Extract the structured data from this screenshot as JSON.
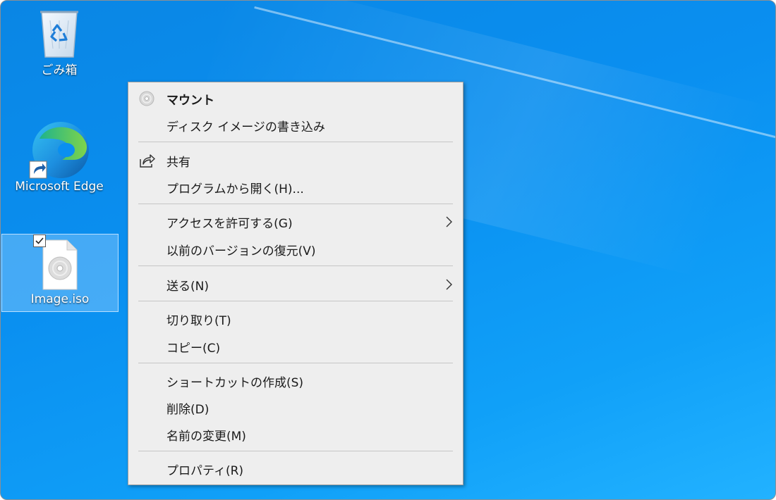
{
  "desktop": {
    "icons": [
      {
        "label": "ごみ箱",
        "icon": "recycle-bin-icon"
      },
      {
        "label": "Microsoft Edge",
        "icon": "edge-icon"
      },
      {
        "label": "Image.iso",
        "icon": "disc-image-file-icon",
        "selected": true,
        "checked": true
      }
    ]
  },
  "context_menu": {
    "items": [
      {
        "label": "マウント",
        "bold": true,
        "icon": "disc-icon"
      },
      {
        "label": "ディスク イメージの書き込み"
      },
      {
        "label": "共有",
        "icon": "share-icon"
      },
      {
        "label": "プログラムから開く(H)..."
      },
      {
        "label": "アクセスを許可する(G)",
        "submenu": true
      },
      {
        "label": "以前のバージョンの復元(V)"
      },
      {
        "label": "送る(N)",
        "submenu": true
      },
      {
        "label": "切り取り(T)"
      },
      {
        "label": "コピー(C)"
      },
      {
        "label": "ショートカットの作成(S)"
      },
      {
        "label": "削除(D)"
      },
      {
        "label": "名前の変更(M)"
      },
      {
        "label": "プロパティ(R)"
      }
    ]
  },
  "colors": {
    "desktop_blue": "#0a8ff0",
    "menu_bg": "#eeeeee",
    "selection": "#99d1ff"
  }
}
